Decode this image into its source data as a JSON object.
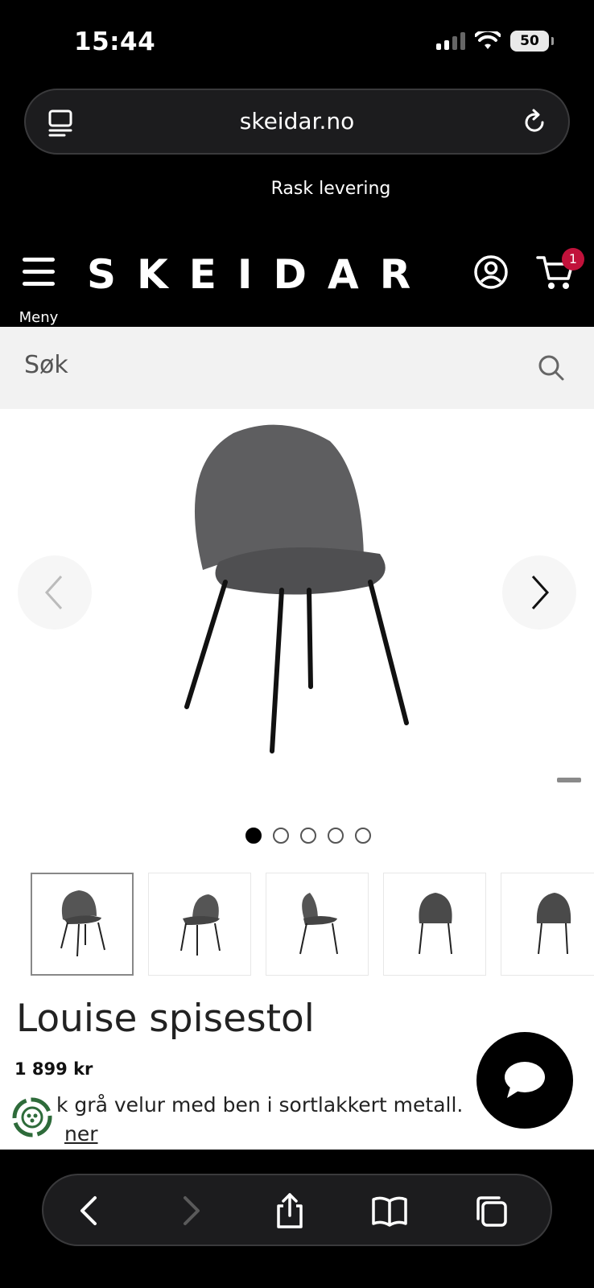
{
  "status_bar": {
    "time": "15:44",
    "battery": "50",
    "icons": [
      "cellular-signal-icon",
      "wifi-icon",
      "battery-icon"
    ]
  },
  "browser": {
    "url": "skeidar.no",
    "toolbar_icons": [
      "back-icon",
      "forward-icon",
      "share-icon",
      "bookmarks-icon",
      "tabs-icon"
    ]
  },
  "promo": {
    "text": "Rask levering"
  },
  "header": {
    "menu_label": "Meny",
    "logo": "SKEIDAR",
    "cart_count": "1",
    "badge_color": "#c1123b"
  },
  "search": {
    "placeholder": "Søk"
  },
  "product": {
    "title": "Louise spisestol",
    "price": "1 899 kr",
    "description": "k grå velur med ben i sortlakkert metall.",
    "read_more": "ner",
    "gallery": {
      "image_count": 5,
      "active_index": 0,
      "thumbnails": [
        "chair-front-angle",
        "chair-side-angle",
        "chair-side",
        "chair-back",
        "chair-back-angle"
      ]
    }
  }
}
